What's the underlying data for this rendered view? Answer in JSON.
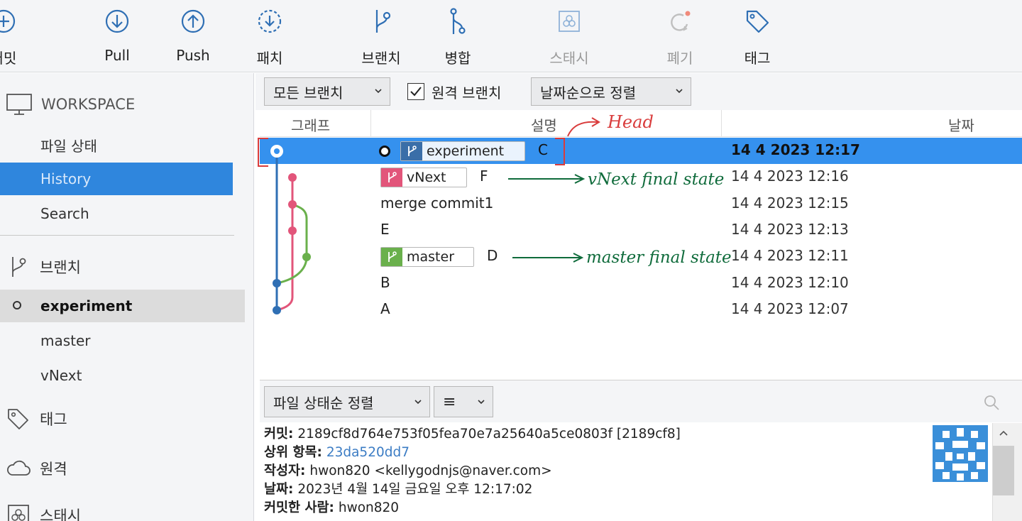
{
  "toolbar": {
    "commit": "커밋",
    "pull": "Pull",
    "push": "Push",
    "patch": "패치",
    "branch": "브랜치",
    "merge": "병합",
    "stash": "스태시",
    "discard": "폐기",
    "tag": "태그"
  },
  "sidebar": {
    "workspace": "WORKSPACE",
    "file_status": "파일 상태",
    "history": "History",
    "search": "Search",
    "branches_header": "브랜치",
    "branches": [
      "experiment",
      "master",
      "vNext"
    ],
    "tags_header": "태그",
    "remotes_header": "원격",
    "stashes_header": "스태시"
  },
  "filter": {
    "all_branches": "모든 브랜치",
    "remote_branches": "원격 브랜치",
    "sort": "날짜순으로 정렬"
  },
  "columns": {
    "graph": "그래프",
    "description": "설명",
    "date": "날짜"
  },
  "commits": [
    {
      "desc": "C",
      "date": "14 4 2023 12:17",
      "branch": "experiment"
    },
    {
      "desc": "F",
      "date": "14 4 2023 12:16",
      "branch": "vNext"
    },
    {
      "desc": "merge commit1",
      "date": "14 4 2023 12:15"
    },
    {
      "desc": "E",
      "date": "14 4 2023 12:13"
    },
    {
      "desc": "D",
      "date": "14 4 2023 12:11",
      "branch": "master"
    },
    {
      "desc": "B",
      "date": "14 4 2023 12:10"
    },
    {
      "desc": "A",
      "date": "14 4 2023 12:07"
    }
  ],
  "lower": {
    "sort_by_status": "파일 상태순 정렬",
    "list_view_glyph": "≡"
  },
  "details": {
    "commit_label": "커밋:",
    "commit_value": "2189cf8d764e753f05fea70e7a25640a5ce0803f [2189cf8]",
    "parents_label": "상위 항목:",
    "parents_value": "23da520dd7",
    "author_label": "작성자:",
    "author_value": "hwon820 <kellygodnjs@naver.com>",
    "date_label": "날짜:",
    "date_value": "2023년 4월 14일 금요일 오후 12:17:02",
    "committer_label": "커밋한 사람:",
    "committer_value": "hwon820"
  },
  "annotations": {
    "head": "Head",
    "vnext": "vNext final state",
    "master": "master final state"
  },
  "colors": {
    "selection": "#3591ee",
    "sidebar_selection": "#2f86dd",
    "lane_blue": "#2f6fb4",
    "lane_pink": "#e2557a",
    "lane_green": "#6ab04c",
    "annotation_red": "#d93c3c",
    "annotation_green": "#0f6b3b"
  }
}
